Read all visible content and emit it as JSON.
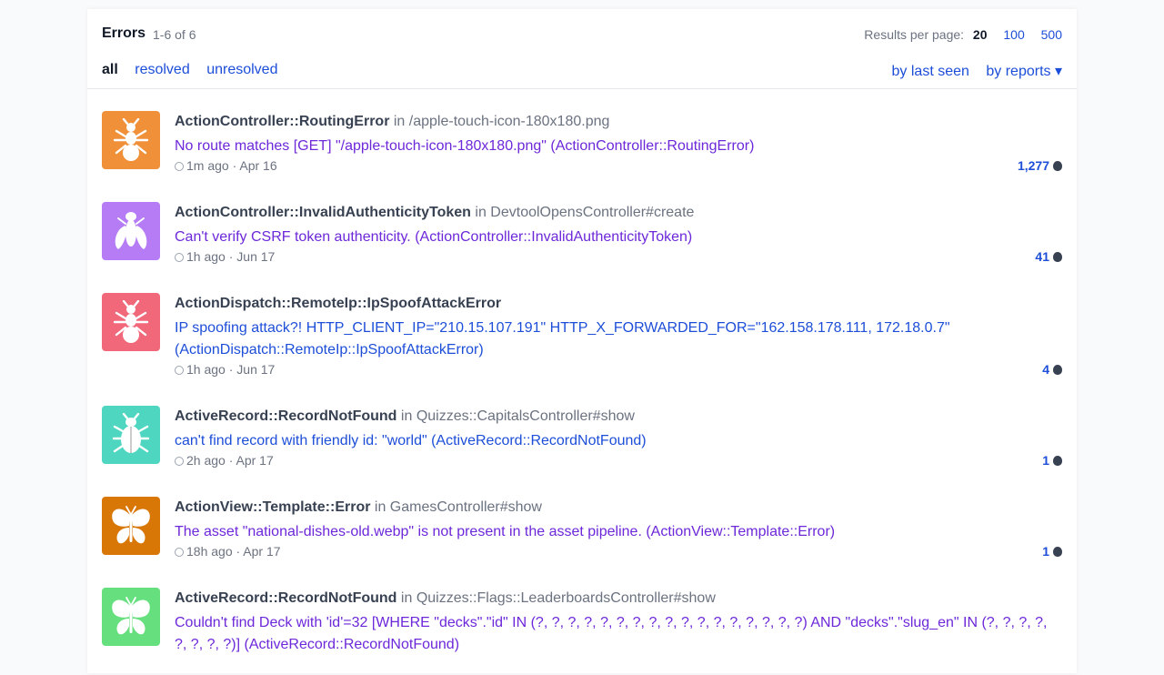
{
  "header": {
    "title": "Errors",
    "count": "1-6 of 6",
    "results_label": "Results per page:",
    "results_selected": "20",
    "results_options": [
      "100",
      "500"
    ]
  },
  "filters": [
    "all",
    "resolved",
    "unresolved"
  ],
  "sorts": [
    "by last seen",
    "by reports ▾"
  ],
  "errors": [
    {
      "icon": "ant-icon",
      "color": "#f0913a",
      "class_name": "ActionController::RoutingError",
      "in_prefix": "in",
      "location": "/apple-touch-icon-180x180.png",
      "message": "No route matches [GET] \"/apple-touch-icon-180x180.png\" (ActionController::RoutingError)",
      "msg_color": "#6d28d9",
      "ago": "1m ago",
      "date": "Apr 16",
      "reports": "1,277"
    },
    {
      "icon": "fly-icon",
      "color": "#b57cf5",
      "class_name": "ActionController::InvalidAuthenticityToken",
      "in_prefix": "in",
      "location": "DevtoolOpensController#create",
      "message": "Can't verify CSRF token authenticity. (ActionController::InvalidAuthenticityToken)",
      "msg_color": "#6d28d9",
      "ago": "1h ago",
      "date": "Jun 17",
      "reports": "41"
    },
    {
      "icon": "ant-icon",
      "color": "#f0687a",
      "class_name": "ActionDispatch::RemoteIp::IpSpoofAttackError",
      "in_prefix": "",
      "location": "",
      "message": "IP spoofing attack?! HTTP_CLIENT_IP=\"210.15.107.191\" HTTP_X_FORWARDED_FOR=\"162.158.178.111, 172.18.0.7\" (ActionDispatch::RemoteIp::IpSpoofAttackError)",
      "msg_color": "#1d4ed8",
      "ago": "1h ago",
      "date": "Jun 17",
      "reports": "4"
    },
    {
      "icon": "beetle-icon",
      "color": "#4fd6c0",
      "class_name": "ActiveRecord::RecordNotFound",
      "in_prefix": "in",
      "location": "Quizzes::CapitalsController#show",
      "message": "can't find record with friendly id: \"world\" (ActiveRecord::RecordNotFound)",
      "msg_color": "#1d4ed8",
      "ago": "2h ago",
      "date": "Apr 17",
      "reports": "1"
    },
    {
      "icon": "butterfly-icon",
      "color": "#d97706",
      "class_name": "ActionView::Template::Error",
      "in_prefix": "in",
      "location": "GamesController#show",
      "message": "The asset \"national-dishes-old.webp\" is not present in the asset pipeline. (ActionView::Template::Error)",
      "msg_color": "#6d28d9",
      "ago": "18h ago",
      "date": "Apr 17",
      "reports": "1"
    },
    {
      "icon": "butterfly-icon",
      "color": "#66e07f",
      "class_name": "ActiveRecord::RecordNotFound",
      "in_prefix": "in",
      "location": "Quizzes::Flags::LeaderboardsController#show",
      "message": "Couldn't find Deck with 'id'=32 [WHERE \"decks\".\"id\" IN (?, ?, ?, ?, ?, ?, ?, ?, ?, ?, ?, ?, ?, ?, ?, ?, ?) AND \"decks\".\"slug_en\" IN (?, ?, ?, ?, ?, ?, ?, ?)] (ActiveRecord::RecordNotFound)",
      "msg_color": "#6d28d9",
      "ago": "",
      "date": "",
      "reports": ""
    }
  ]
}
